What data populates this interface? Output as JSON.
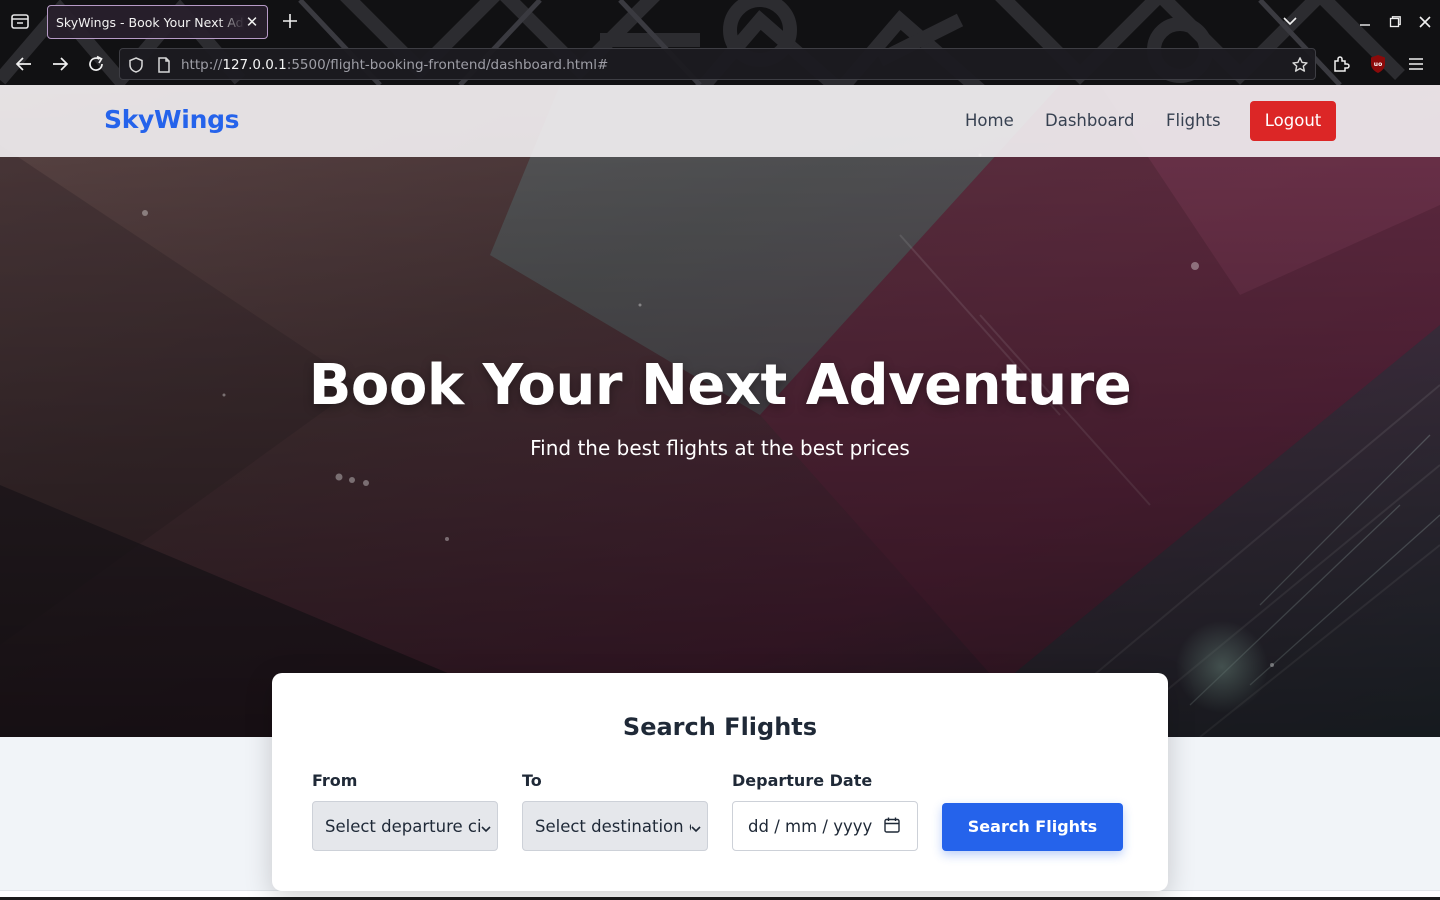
{
  "browser": {
    "tab_title": "SkyWings - Book Your Next Adventure",
    "url_scheme": "http://",
    "url_host": "127.0.0.1",
    "url_rest": ":5500/flight-booking-frontend/dashboard.html#"
  },
  "nav": {
    "brand": "SkyWings",
    "links": [
      "Home",
      "Dashboard",
      "Flights"
    ],
    "logout": "Logout"
  },
  "hero": {
    "title": "Book Your Next Adventure",
    "subtitle": "Find the best flights at the best prices"
  },
  "search": {
    "title": "Search Flights",
    "from_label": "From",
    "from_value": "Select departure city",
    "to_label": "To",
    "to_value": "Select destination city",
    "date_label": "Departure Date",
    "date_value": "dd / mm / yyyy",
    "button": "Search Flights"
  },
  "colors": {
    "brand": "#2563eb",
    "logout": "#dc2626",
    "primary_button": "#2563eb"
  }
}
